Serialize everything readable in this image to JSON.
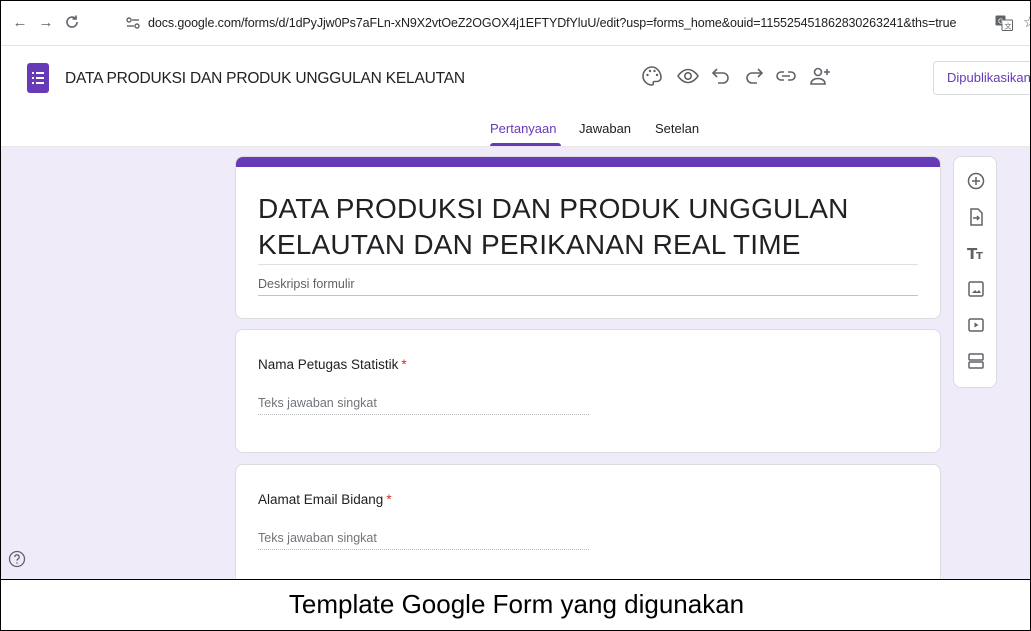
{
  "browser": {
    "url": "docs.google.com/forms/d/1dPyJjw0Ps7aFLn-xN9X2vtOeZ2OGOX4j1EFTYDfYluU/edit?usp=forms_home&ouid=115525451862830263241&ths=true"
  },
  "header": {
    "doc_title": "DATA PRODUKSI DAN PRODUK UNGGULAN KELAUTAN",
    "publish_label": "Dipublikasikan",
    "accent_color": "#673ab7"
  },
  "tabs": [
    {
      "label": "Pertanyaan",
      "active": true
    },
    {
      "label": "Jawaban",
      "active": false
    },
    {
      "label": "Setelan",
      "active": false
    }
  ],
  "form": {
    "title": "DATA PRODUKSI DAN PRODUK UNGGULAN KELAUTAN DAN PERIKANAN REAL TIME",
    "description_placeholder": "Deskripsi formulir",
    "background_color": "#f0ebf8",
    "questions": [
      {
        "label": "Nama Petugas Statistik",
        "required_mark": "*",
        "answer_placeholder": "Teks jawaban singkat"
      },
      {
        "label": "Alamat Email Bidang",
        "required_mark": "*",
        "answer_placeholder": "Teks jawaban singkat"
      }
    ]
  },
  "toolbar_icons": [
    "add-question-icon",
    "import-questions-icon",
    "add-title-icon",
    "add-image-icon",
    "add-video-icon",
    "add-section-icon"
  ],
  "caption": "Template Google Form yang digunakan"
}
